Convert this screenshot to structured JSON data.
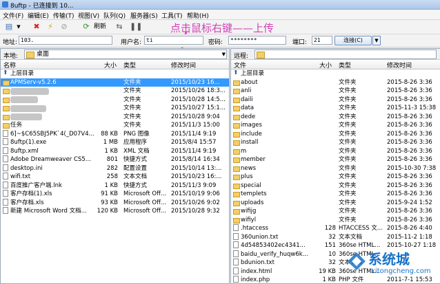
{
  "window": {
    "title": "8uftp - 已连接到 10..."
  },
  "menu": [
    "文件(F)",
    "编辑(E)",
    "传输(T)",
    "视图(V)",
    "队列(Q)",
    "服务器(S)",
    "工具(T)",
    "帮助(H)"
  ],
  "toolbar": {
    "refresh_label": "刷新"
  },
  "annotation": "点击鼠标右键——上传",
  "connection": {
    "address_label": "地址:",
    "address_value": "103.",
    "user_label": "用户名:",
    "user_value": "ti",
    "password_label": "密码:",
    "password_value": "********",
    "port_label": "端口:",
    "port_value": "21",
    "connect_label": "连接(C)"
  },
  "local": {
    "path_label": "本地:",
    "path_value": "桌面",
    "headers": {
      "name": "名称",
      "size": "大小",
      "type": "类型",
      "modified": "修改时间"
    },
    "files": [
      {
        "name": "上层目录",
        "size": "",
        "type": "",
        "modified": "",
        "icon": "up"
      },
      {
        "name": "APMServ-v5.2.6",
        "size": "",
        "type": "文件夹",
        "modified": "2015/10/23 16...",
        "icon": "folder",
        "selected": true
      },
      {
        "name": "",
        "size": "",
        "type": "文件夹",
        "modified": "2015/10/26 18:3...",
        "icon": "folder"
      },
      {
        "name": "",
        "size": "",
        "type": "文件夹",
        "modified": "2015/10/28 14:5...",
        "icon": "folder"
      },
      {
        "name": "",
        "size": "",
        "type": "文件夹",
        "modified": "2015/10/27 15:1...",
        "icon": "folder"
      },
      {
        "name": "",
        "size": "",
        "type": "文件夹",
        "modified": "2015/10/28 9:04",
        "icon": "folder"
      },
      {
        "name": "任务",
        "size": "",
        "type": "文件夹",
        "modified": "2015/11/3 15:00",
        "icon": "folder"
      },
      {
        "name": "6]~$C65SBJ5PK`4(_D07V4...",
        "size": "88 KB",
        "type": "PNG 图像",
        "modified": "2015/11/4 9:19",
        "icon": "file"
      },
      {
        "name": "8uftp(1).exe",
        "size": "1 MB",
        "type": "应用程序",
        "modified": "2015/8/4 15:57",
        "icon": "file"
      },
      {
        "name": "8uftp.xml",
        "size": "1 KB",
        "type": "XML 文档",
        "modified": "2015/11/4 9:19",
        "icon": "file"
      },
      {
        "name": "Adobe Dreamweaver CS5...",
        "size": "801",
        "type": "快捷方式",
        "modified": "2015/8/14 16:34",
        "icon": "file"
      },
      {
        "name": "desktop.ini",
        "size": "282",
        "type": "配置设置",
        "modified": "2015/10/14 13:...",
        "icon": "file"
      },
      {
        "name": "wifi.txt",
        "size": "258",
        "type": "文本文档",
        "modified": "2015/10/23 16:...",
        "icon": "file"
      },
      {
        "name": "百度推广客户端.lnk",
        "size": "1 KB",
        "type": "快捷方式",
        "modified": "2015/11/3 9:09",
        "icon": "file"
      },
      {
        "name": "客户存档(1).xls",
        "size": "91 KB",
        "type": "Microsoft Off...",
        "modified": "2015/10/19 9:06",
        "icon": "file"
      },
      {
        "name": "客户存档.xls",
        "size": "93 KB",
        "type": "Microsoft Off...",
        "modified": "2015/10/26 9:02",
        "icon": "file"
      },
      {
        "name": "新建 Microsoft Word 文档...",
        "size": "120 KB",
        "type": "Microsoft Off...",
        "modified": "2015/10/28 9:32",
        "icon": "file"
      }
    ]
  },
  "remote": {
    "path_label": "远程:",
    "headers": {
      "name": "文件",
      "size": "大小",
      "type": "类型",
      "modified": "修改时间"
    },
    "files": [
      {
        "name": "上层目录",
        "size": "",
        "type": "",
        "modified": "",
        "icon": "up"
      },
      {
        "name": "about",
        "size": "",
        "type": "文件夹",
        "modified": "2015-8-26 3:36",
        "icon": "folder"
      },
      {
        "name": "anli",
        "size": "",
        "type": "文件夹",
        "modified": "2015-8-26 3:36",
        "icon": "folder"
      },
      {
        "name": "daili",
        "size": "",
        "type": "文件夹",
        "modified": "2015-8-26 3:36",
        "icon": "folder"
      },
      {
        "name": "data",
        "size": "",
        "type": "文件夹",
        "modified": "2015-11-3 15:38",
        "icon": "folder"
      },
      {
        "name": "dede",
        "size": "",
        "type": "文件夹",
        "modified": "2015-8-26 3:36",
        "icon": "folder"
      },
      {
        "name": "images",
        "size": "",
        "type": "文件夹",
        "modified": "2015-8-26 3:36",
        "icon": "folder"
      },
      {
        "name": "include",
        "size": "",
        "type": "文件夹",
        "modified": "2015-8-26 3:36",
        "icon": "folder"
      },
      {
        "name": "install",
        "size": "",
        "type": "文件夹",
        "modified": "2015-8-26 3:36",
        "icon": "folder"
      },
      {
        "name": "m",
        "size": "",
        "type": "文件夹",
        "modified": "2015-8-26 3:36",
        "icon": "folder"
      },
      {
        "name": "member",
        "size": "",
        "type": "文件夹",
        "modified": "2015-8-26 3:36",
        "icon": "folder"
      },
      {
        "name": "news",
        "size": "",
        "type": "文件夹",
        "modified": "2015-10-30 7:38",
        "icon": "folder"
      },
      {
        "name": "plus",
        "size": "",
        "type": "文件夹",
        "modified": "2015-8-26 3:36",
        "icon": "folder"
      },
      {
        "name": "special",
        "size": "",
        "type": "文件夹",
        "modified": "2015-8-26 3:36",
        "icon": "folder"
      },
      {
        "name": "templets",
        "size": "",
        "type": "文件夹",
        "modified": "2015-8-26 3:36",
        "icon": "folder"
      },
      {
        "name": "uploads",
        "size": "",
        "type": "文件夹",
        "modified": "2015-9-24 1:52",
        "icon": "folder"
      },
      {
        "name": "wifijg",
        "size": "",
        "type": "文件夹",
        "modified": "2015-8-26 3:36",
        "icon": "folder"
      },
      {
        "name": "wifiyl",
        "size": "",
        "type": "文件夹",
        "modified": "2015-8-26 3:36",
        "icon": "folder"
      },
      {
        "name": ".htaccess",
        "size": "128",
        "type": "HTACCESS 文...",
        "modified": "2015-8-26 4:40",
        "icon": "file"
      },
      {
        "name": "360union.txt",
        "size": "32",
        "type": "文本文档",
        "modified": "2015-11-2 1:18",
        "icon": "file"
      },
      {
        "name": "4d54853402ec4341...",
        "size": "151",
        "type": "360se HTML...",
        "modified": "2015-10-27 1:18",
        "icon": "file"
      },
      {
        "name": "baidu_verify_huqw6k...",
        "size": "10",
        "type": "360se HTML...",
        "modified": "",
        "icon": "file"
      },
      {
        "name": "bdunion.txt",
        "size": "32",
        "type": "文本文档",
        "modified": "",
        "icon": "file"
      },
      {
        "name": "index.html",
        "size": "19 KB",
        "type": "360se HTML...",
        "modified": "",
        "icon": "file"
      },
      {
        "name": "index.php",
        "size": "1 KB",
        "type": "PHP 文件",
        "modified": "2011-7-1 15:53",
        "icon": "file"
      }
    ]
  },
  "watermark": {
    "text": "系统城",
    "sub": "xitongcheng.com"
  }
}
